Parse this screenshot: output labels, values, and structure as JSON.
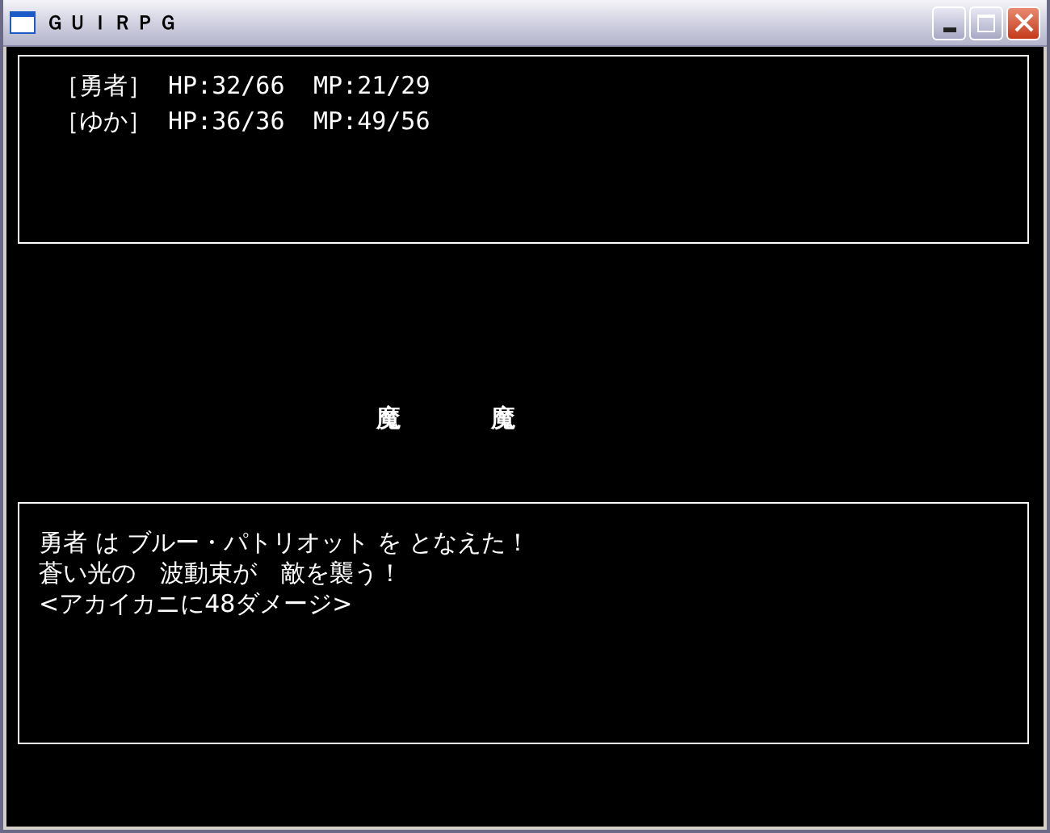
{
  "window": {
    "title": "ＧＵＩＲＰＧ"
  },
  "party": [
    {
      "name": "［勇者］",
      "hp": "HP:32/66",
      "mp": "MP:21/29"
    },
    {
      "name": "［ゆか］",
      "hp": "HP:36/36",
      "mp": "MP:49/56"
    }
  ],
  "enemies": [
    "魔",
    "魔"
  ],
  "messages": [
    "勇者 は ブルー・パトリオット を となえた！",
    "蒼い光の　波動束が　敵を襲う！",
    "<アカイカニに48ダメージ>"
  ]
}
